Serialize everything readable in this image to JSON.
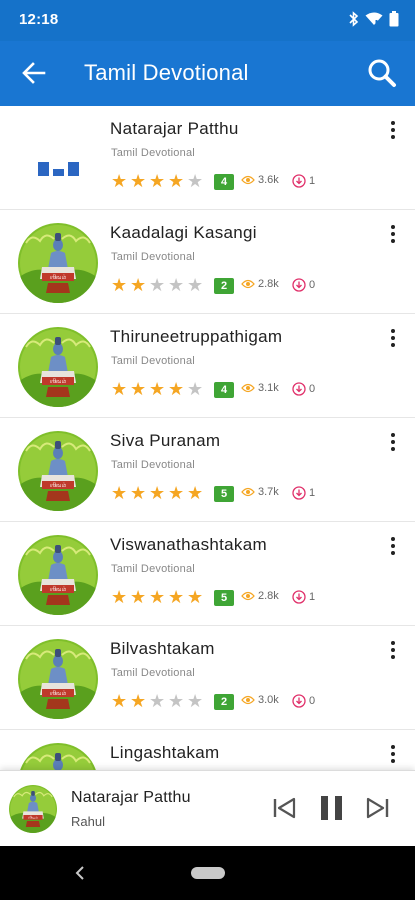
{
  "status_bar": {
    "time": "12:18",
    "icons": [
      "bluetooth-icon",
      "wifi-icon",
      "battery-icon"
    ]
  },
  "app_bar": {
    "title": "Tamil Devotional",
    "back_icon": "arrow-back-icon",
    "search_icon": "search-icon"
  },
  "songs": [
    {
      "title": "Natarajar Patthu",
      "subtitle": "Tamil Devotional",
      "rating": 4,
      "rating_label": "4",
      "views": "3.6k",
      "downloads": "1",
      "thumbnail": "placeholder"
    },
    {
      "title": "Kaadalagi Kasangi",
      "subtitle": "Tamil Devotional",
      "rating": 2,
      "rating_label": "2",
      "views": "2.8k",
      "downloads": "0",
      "thumbnail": "shiva-art"
    },
    {
      "title": "Thiruneetruppathigam",
      "subtitle": "Tamil Devotional",
      "rating": 4,
      "rating_label": "4",
      "views": "3.1k",
      "downloads": "0",
      "thumbnail": "shiva-art"
    },
    {
      "title": "Siva Puranam",
      "subtitle": "Tamil Devotional",
      "rating": 5,
      "rating_label": "5",
      "views": "3.7k",
      "downloads": "1",
      "thumbnail": "shiva-art"
    },
    {
      "title": "Viswanathashtakam",
      "subtitle": "Tamil Devotional",
      "rating": 5,
      "rating_label": "5",
      "views": "2.8k",
      "downloads": "1",
      "thumbnail": "shiva-art"
    },
    {
      "title": "Bilvashtakam",
      "subtitle": "Tamil Devotional",
      "rating": 2,
      "rating_label": "2",
      "views": "3.0k",
      "downloads": "0",
      "thumbnail": "shiva-art"
    },
    {
      "title": "Lingashtakam",
      "subtitle": "",
      "rating": 0,
      "rating_label": "",
      "views": "",
      "downloads": "",
      "thumbnail": "shiva-art"
    }
  ],
  "player": {
    "title": "Natarajar Patthu",
    "artist": "Rahul",
    "state": "playing"
  },
  "colors": {
    "primary": "#1976d2",
    "status_bar": "#1572c9",
    "star": "#f5a623",
    "rating_badge": "#3fa535",
    "views_icon": "#f5a623",
    "download_icon": "#e0306a"
  }
}
